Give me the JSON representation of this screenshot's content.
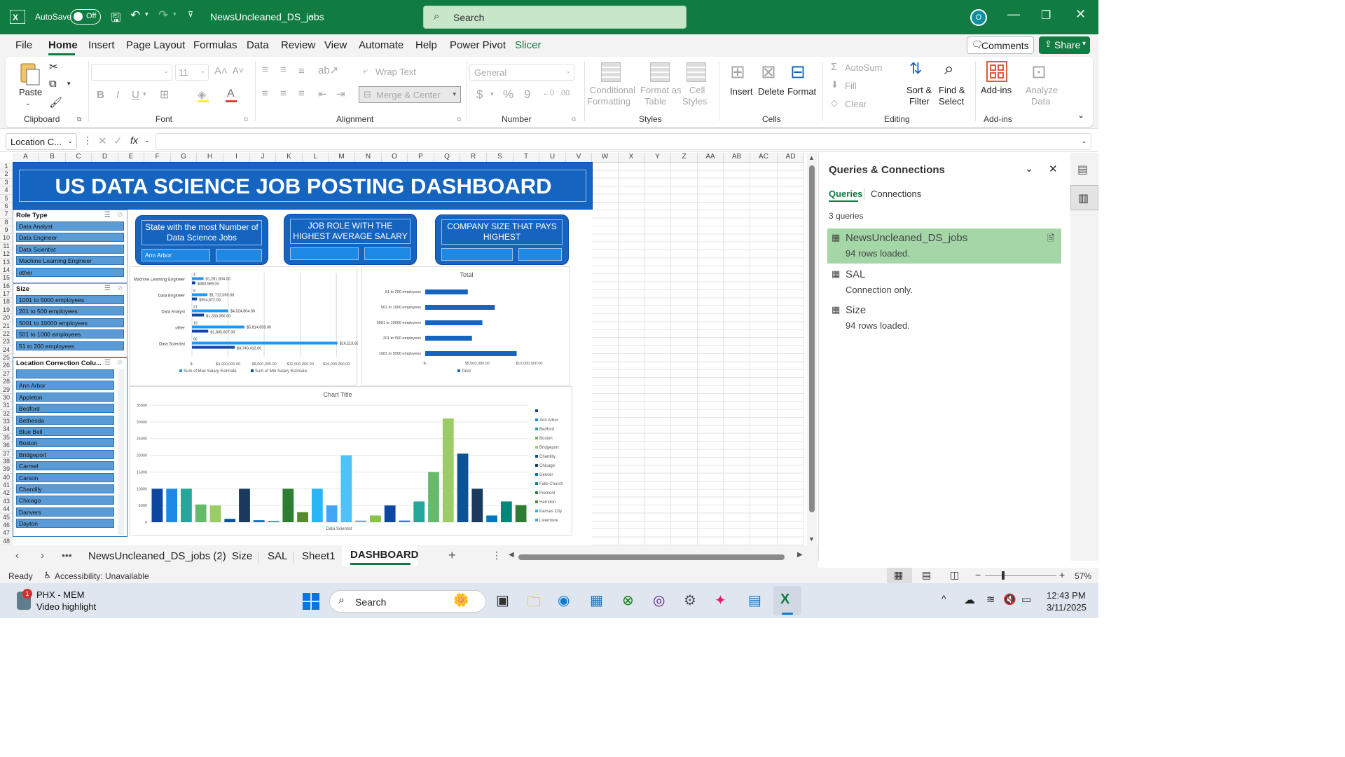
{
  "titlebar": {
    "autosave": "AutoSave",
    "autosave_state": "Off",
    "filename": "NewsUncleaned_DS_jobs",
    "search_placeholder": "Search",
    "avatar": "O"
  },
  "menu": [
    "File",
    "Home",
    "Insert",
    "Page Layout",
    "Formulas",
    "Data",
    "Review",
    "View",
    "Automate",
    "Help",
    "Power Pivot",
    "Slicer"
  ],
  "menu_active": "Home",
  "menu_extra": "Slicer",
  "comments_label": "Comments",
  "share_label": "Share",
  "ribbon": {
    "clipboard": {
      "paste": "Paste",
      "group": "Clipboard"
    },
    "font": {
      "size": "11",
      "group": "Font",
      "bold": "B",
      "italic": "I",
      "underline": "U"
    },
    "alignment": {
      "wrap": "Wrap Text",
      "merge": "Merge & Center",
      "group": "Alignment"
    },
    "number": {
      "format": "General",
      "group": "Number",
      "currency": "$",
      "percent": "%",
      "comma": "9"
    },
    "styles": {
      "cond": "Conditional",
      "cond2": "Formatting",
      "fmt_table": "Format as",
      "fmt_table2": "Table",
      "cell_styles": "Cell",
      "cell_styles2": "Styles",
      "group": "Styles"
    },
    "cells": {
      "insert": "Insert",
      "delete": "Delete",
      "format": "Format",
      "group": "Cells"
    },
    "editing": {
      "autosum": "AutoSum",
      "fill": "Fill",
      "clear": "Clear",
      "sort": "Sort &",
      "sort2": "Filter",
      "find": "Find &",
      "find2": "Select",
      "group": "Editing"
    },
    "addins": {
      "addins": "Add-ins",
      "group": "Add-ins",
      "analyze": "Analyze",
      "analyze2": "Data"
    }
  },
  "formula_bar": {
    "namebox": "Location C...",
    "fx": "fx",
    "value": ""
  },
  "columns": [
    "A",
    "B",
    "C",
    "D",
    "E",
    "F",
    "G",
    "H",
    "I",
    "J",
    "K",
    "L",
    "M",
    "N",
    "O",
    "P",
    "Q",
    "R",
    "S",
    "T",
    "U",
    "V",
    "W",
    "X",
    "Y",
    "Z",
    "AA",
    "AB",
    "AC",
    "AD"
  ],
  "rows": [
    "1",
    "2",
    "3",
    "4",
    "5",
    "6",
    "7",
    "8",
    "9",
    "10",
    "11",
    "12",
    "13",
    "14",
    "15",
    "16",
    "17",
    "18",
    "19",
    "20",
    "21",
    "22",
    "23",
    "24",
    "25",
    "26",
    "27",
    "28",
    "29",
    "30",
    "31",
    "32",
    "33",
    "34",
    "35",
    "36",
    "37",
    "38",
    "39",
    "40",
    "41",
    "42",
    "43",
    "44",
    "45",
    "46",
    "47",
    "48"
  ],
  "dashboard": {
    "title": "US DATA SCIENCE  JOB POSTING DASHBOARD",
    "slicers": {
      "role": {
        "title": "Role Type",
        "items": [
          "Data Analyst",
          "Data Engineer",
          "Data Scientist",
          "Machine Learning Engineer",
          "other"
        ]
      },
      "size": {
        "title": "Size",
        "items": [
          "1001 to 5000 employees",
          "201 to 500 employees",
          "5001 to 10000 employees",
          "501 to 1000 employees",
          "51 to 200 employees"
        ]
      },
      "location": {
        "title": "Location Correction Colu...",
        "items": [
          "",
          "Ann Arbor",
          "Appleton",
          "Bedford",
          "Bethesda",
          "Blue Bell",
          "Boston",
          "Bridgeport",
          "Carmel",
          "Carson",
          "Chantilly",
          "Chicago",
          "Danvers",
          "Dayton"
        ]
      }
    },
    "cards": [
      {
        "title": "State with the most Number of Data Science Jobs",
        "value": "Ann Arbor",
        "value2": ""
      },
      {
        "title": "JOB ROLE WITH THE HIGHEST AVERAGE SALARY",
        "value": "",
        "value2": ""
      },
      {
        "title": "COMPANY SIZE THAT PAYS HIGHEST",
        "value": "",
        "value2": ""
      }
    ]
  },
  "chart_data": [
    {
      "type": "bar",
      "orientation": "horizontal",
      "title": "",
      "categories": [
        "Machine Learning Engineer",
        "Data Engineer",
        "Data Analyst",
        "other",
        "Data Scientist"
      ],
      "series": [
        {
          "name": "Sum of Max Salary Estimate",
          "values": [
            1281804,
            1712069,
            4024804,
            5814859,
            16113924
          ],
          "labels": [
            "$1,281,804.00",
            "$1,712,069.00",
            "$4,024,804.00",
            "$5,814,859.00",
            "$16,113,924.00"
          ]
        },
        {
          "name": "Sum of Min Salary Estimate",
          "values": [
            383989,
            554872,
            1333366,
            1805807,
            4740412
          ],
          "labels": [
            "$383,989.00",
            "$554,872.00",
            "$1,333,366.00",
            "$1,805,807.00",
            "$4,740,412.00"
          ]
        }
      ],
      "small_labels": [
        "4",
        "6",
        "21",
        "10",
        "60"
      ],
      "xticks": [
        "$-",
        "$4,000,000.00",
        "$8,000,000.00",
        "$12,000,000.00",
        "$16,000,000.00"
      ],
      "xlim": [
        0,
        18000000
      ]
    },
    {
      "type": "bar",
      "orientation": "horizontal",
      "title": "Total",
      "categories": [
        "51 to 200 employees",
        "501 to 1000 employees",
        "5001 to 10000 employees",
        "201 to 500 employees",
        "1001 to 5000 employees"
      ],
      "series": [
        {
          "name": "Total",
          "values": [
            4100000,
            6700000,
            5500000,
            4500000,
            8800000
          ]
        }
      ],
      "xticks": [
        "$-",
        "$5,000,000.00",
        "$10,000,000.00"
      ],
      "xlim": [
        0,
        12000000
      ]
    },
    {
      "type": "bar",
      "title": "Chart Title",
      "xlabel": "Data Scientist",
      "yticks": [
        "35000",
        "30000",
        "25000",
        "20000",
        "15000",
        "10000",
        "5000",
        "0"
      ],
      "ylim": [
        0,
        35000
      ],
      "values": [
        10000,
        10000,
        10000,
        5300,
        5000,
        1000,
        10000,
        600,
        300,
        10000,
        3000,
        10000,
        5000,
        20000,
        500,
        2000,
        5000,
        500,
        6200,
        15000,
        31000,
        20500,
        10000,
        2000,
        6200,
        5100
      ],
      "legend": [
        "",
        "Ann Arbor",
        "Bedford",
        "Boston",
        "Bridgeport",
        "Chantilly",
        "Chicago",
        "Denver",
        "Falls Church",
        "Fremont",
        "Herndon",
        "Kansas City",
        "Livermore"
      ],
      "colors": [
        "#0d47a1",
        "#1e88e5",
        "#26a69a",
        "#66bb6a",
        "#9ccc65",
        "#0b5394",
        "#1b3a5c",
        "#0277bd",
        "#00897b",
        "#2e7d32",
        "#558b2f",
        "#29b6f6",
        "#42a5f5",
        "#4fc3f7",
        "#64b5f6",
        "#8bc34a"
      ]
    }
  ],
  "queries": {
    "title": "Queries & Connections",
    "tabs": [
      "Queries",
      "Connections"
    ],
    "count": "3 queries",
    "items": [
      {
        "name": "NewsUncleaned_DS_jobs",
        "sub": "94 rows loaded."
      },
      {
        "name": "SAL",
        "sub": "Connection only."
      },
      {
        "name": "Size",
        "sub": "94 rows loaded."
      }
    ]
  },
  "sheet_tabs": [
    "NewsUncleaned_DS_jobs (2)",
    "Size",
    "SAL",
    "Sheet1",
    "DASHBOARD"
  ],
  "active_tab": "DASHBOARD",
  "status": {
    "ready": "Ready",
    "accessibility": "Accessibility: Unavailable",
    "zoom": "57%"
  },
  "taskbar": {
    "app_title": "PHX - MEM",
    "app_sub": "Video highlight",
    "search": "Search",
    "time": "12:43 PM",
    "date": "3/11/2025",
    "badge": "1"
  }
}
